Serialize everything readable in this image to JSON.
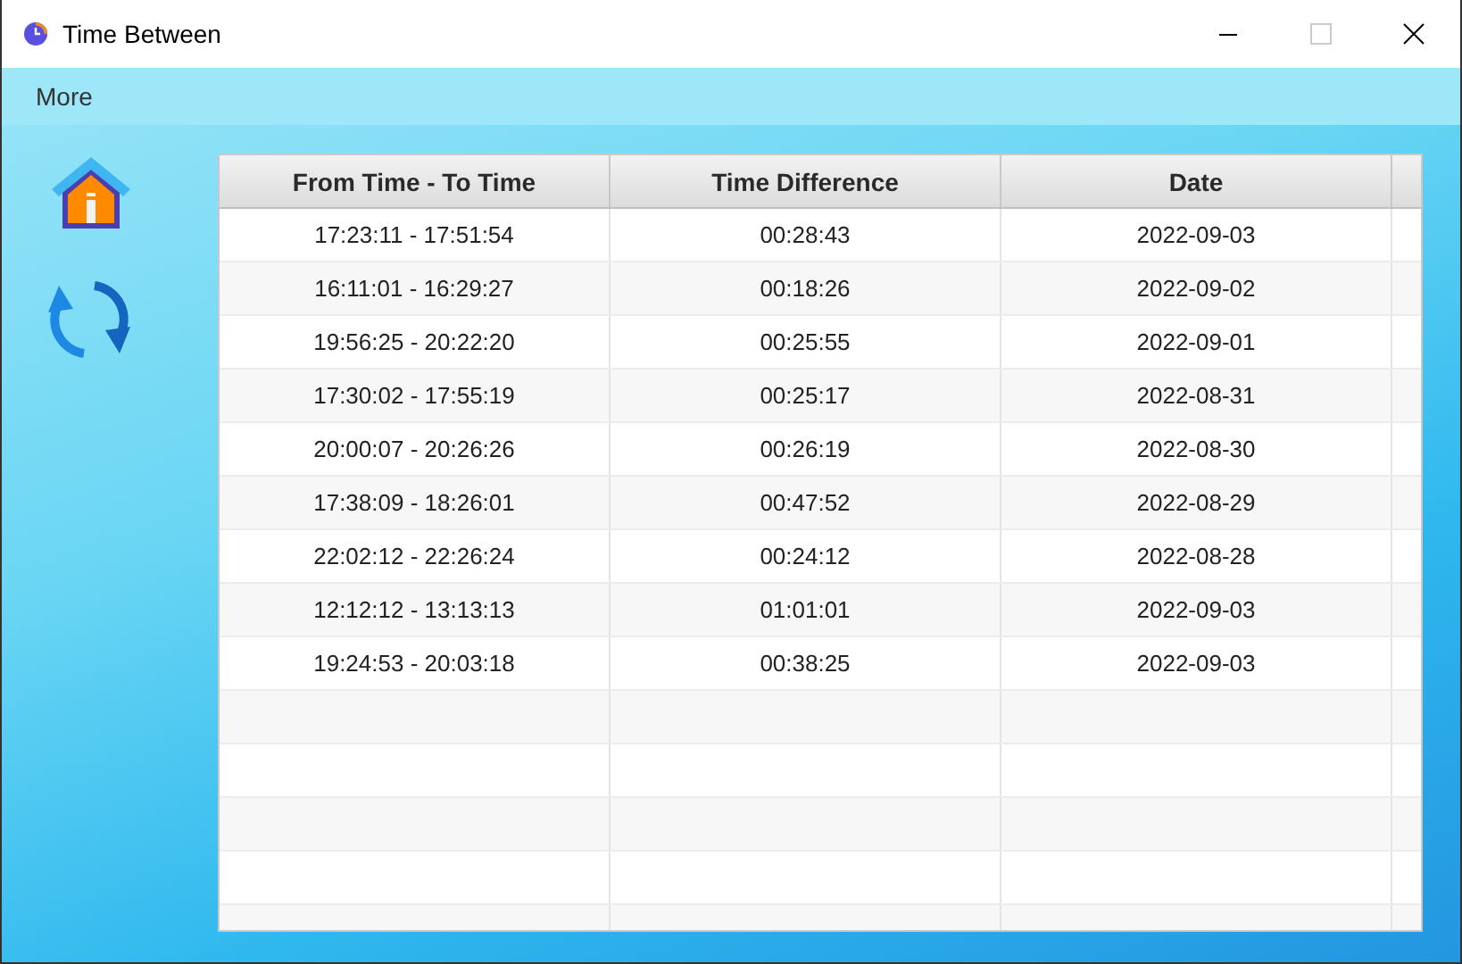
{
  "window": {
    "title": "Time Between"
  },
  "menu": [
    "More"
  ],
  "table": {
    "columns": [
      "From Time - To Time",
      "Time Difference",
      "Date"
    ],
    "rows": [
      [
        "17:23:11 - 17:51:54",
        "00:28:43",
        "2022-09-03"
      ],
      [
        "16:11:01 - 16:29:27",
        "00:18:26",
        "2022-09-02"
      ],
      [
        "19:56:25 - 20:22:20",
        "00:25:55",
        "2022-09-01"
      ],
      [
        "17:30:02 - 17:55:19",
        "00:25:17",
        "2022-08-31"
      ],
      [
        "20:00:07 - 20:26:26",
        "00:26:19",
        "2022-08-30"
      ],
      [
        "17:38:09 - 18:26:01",
        "00:47:52",
        "2022-08-29"
      ],
      [
        "22:02:12 - 22:26:24",
        "00:24:12",
        "2022-08-28"
      ],
      [
        "12:12:12 - 13:13:13",
        "01:01:01",
        "2022-09-03"
      ],
      [
        "19:24:53 - 20:03:18",
        "00:38:25",
        "2022-09-03"
      ]
    ]
  }
}
